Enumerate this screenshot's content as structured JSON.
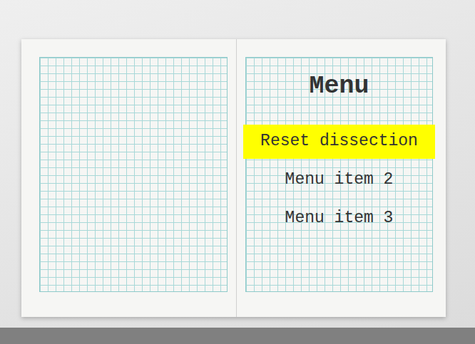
{
  "menu": {
    "title": "Menu",
    "items": [
      {
        "label": "Reset dissection",
        "selected": true
      },
      {
        "label": "Menu item 2",
        "selected": false
      },
      {
        "label": "Menu item 3",
        "selected": false
      }
    ]
  }
}
